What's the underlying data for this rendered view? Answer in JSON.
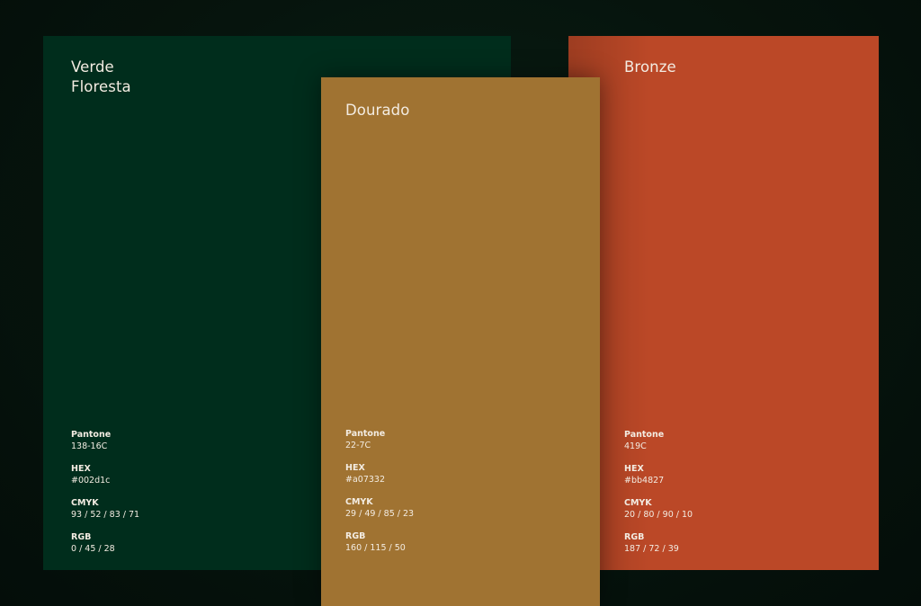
{
  "colors": [
    {
      "name": "Verde\nFloresta",
      "pantone_label": "Pantone",
      "pantone": "138-16C",
      "hex_label": "HEX",
      "hex": "#002d1c",
      "cmyk_label": "CMYK",
      "cmyk": "93 / 52 / 83 / 71",
      "rgb_label": "RGB",
      "rgb": "0 / 45 / 28"
    },
    {
      "name": "Dourado",
      "pantone_label": "Pantone",
      "pantone": "22-7C",
      "hex_label": "HEX",
      "hex": "#a07332",
      "cmyk_label": "CMYK",
      "cmyk": "29 / 49 / 85 / 23",
      "rgb_label": "RGB",
      "rgb": "160 / 115 / 50"
    },
    {
      "name": "Bronze",
      "pantone_label": "Pantone",
      "pantone": "419C",
      "hex_label": "HEX",
      "hex": "#bb4827",
      "cmyk_label": "CMYK",
      "cmyk": "20 / 80 / 90 / 10",
      "rgb_label": "RGB",
      "rgb": "187 / 72 / 39"
    }
  ],
  "theme": {
    "background": "#06140d",
    "text": "#f3ece2"
  }
}
